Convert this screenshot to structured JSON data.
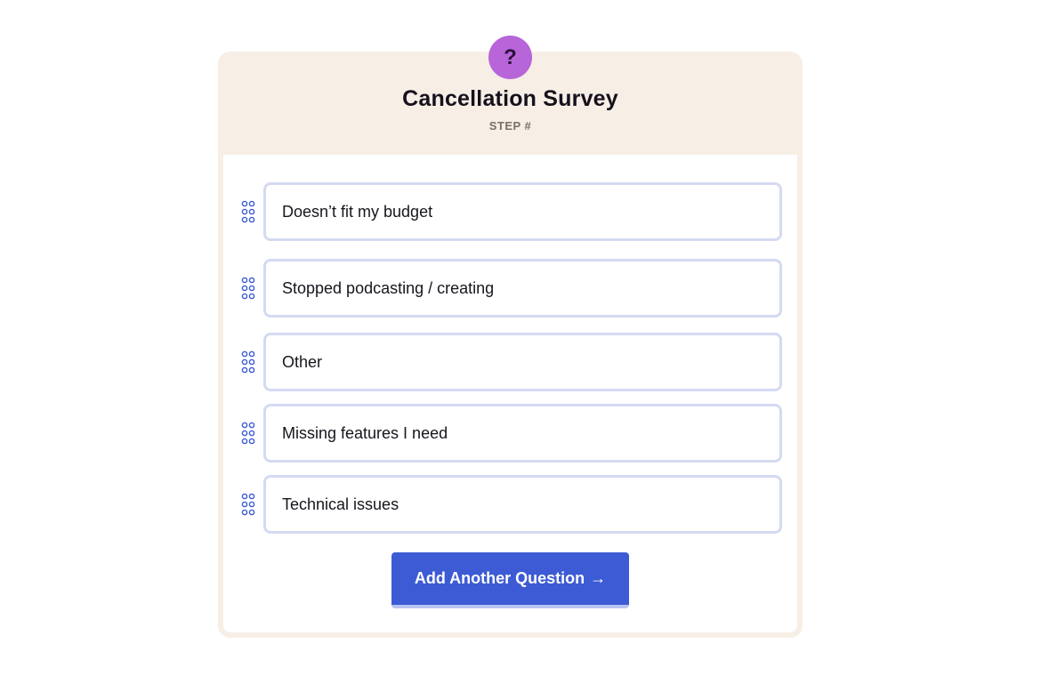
{
  "survey": {
    "badge_icon": "?",
    "title": "Cancellation Survey",
    "step_label": "STEP #",
    "accent_color": "#b765d8",
    "options": [
      {
        "label": "Doesn’t fit my budget",
        "grip_icon": "drag-handle-icon"
      },
      {
        "label": "Stopped podcasting / creating",
        "grip_icon": "drag-handle-icon"
      },
      {
        "label": "Other",
        "grip_icon": "drag-handle-icon"
      },
      {
        "label": "Missing features I need",
        "grip_icon": "drag-handle-icon"
      },
      {
        "label": "Technical issues",
        "grip_icon": "drag-handle-icon"
      }
    ],
    "add_button": {
      "label": "Add Another Question",
      "arrow": "→",
      "color": "#3d5bd4"
    }
  }
}
